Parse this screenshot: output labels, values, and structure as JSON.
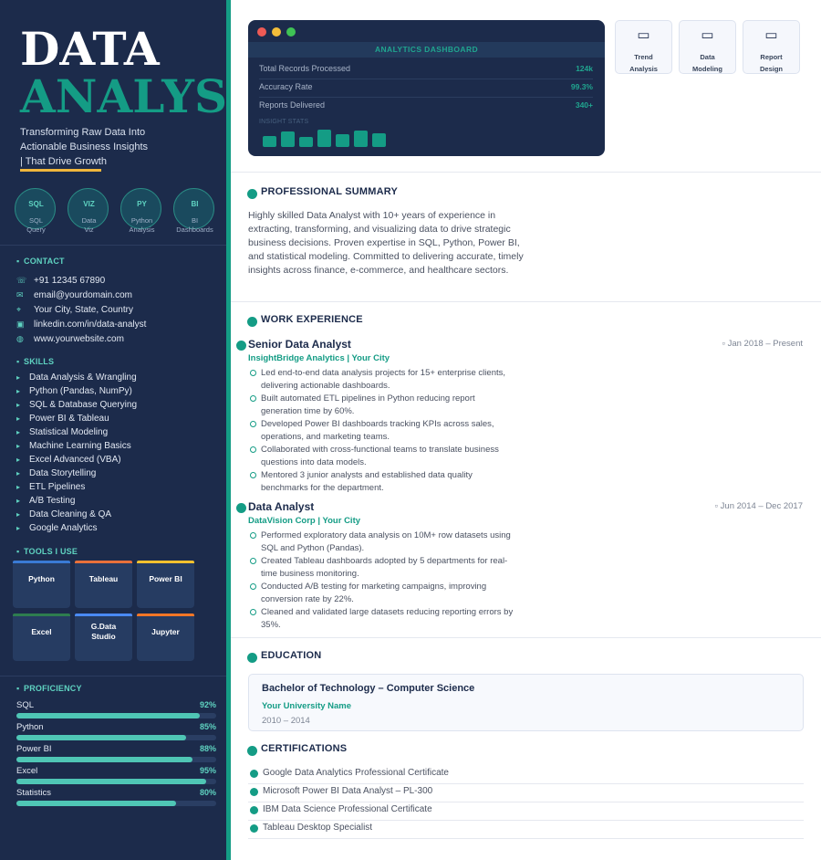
{
  "hero": {
    "line1": "DATA",
    "line2": "ANALYST",
    "tagline_1": "Transforming Raw Data Into",
    "tagline_2": "Actionable Business Insights",
    "tagline_3": "| That Drive Growth"
  },
  "badges": [
    {
      "abbr": "SQL",
      "label_1": "SQL",
      "label_2": "Query"
    },
    {
      "abbr": "VIZ",
      "label_1": "Data",
      "label_2": "Viz"
    },
    {
      "abbr": "PY",
      "label_1": "Python",
      "label_2": "Analysis"
    },
    {
      "abbr": "BI",
      "label_1": "BI",
      "label_2": "Dashboards"
    }
  ],
  "contact": {
    "heading": "CONTACT",
    "items": [
      {
        "icon": "phone-icon",
        "text": "+91 12345 67890"
      },
      {
        "icon": "email-icon",
        "text": "email@yourdomain.com"
      },
      {
        "icon": "location-icon",
        "text": "Your City, State, Country"
      },
      {
        "icon": "linkedin-icon",
        "text": "linkedin.com/in/data-analyst"
      },
      {
        "icon": "globe-icon",
        "text": "www.yourwebsite.com"
      }
    ]
  },
  "skills": {
    "heading": "SKILLS",
    "items": [
      "Data Analysis & Wrangling",
      "Python (Pandas, NumPy)",
      "SQL & Database Querying",
      "Power BI & Tableau",
      "Statistical Modeling",
      "Machine Learning Basics",
      "Excel Advanced (VBA)",
      "Data Storytelling",
      "ETL Pipelines",
      "A/B Testing",
      "Data Cleaning & QA",
      "Google Analytics"
    ]
  },
  "tools": {
    "heading": "TOOLS I USE",
    "items": [
      {
        "name_1": "Python",
        "name_2": "",
        "color": "#3a7bd5"
      },
      {
        "name_1": "Tableau",
        "name_2": "",
        "color": "#e8703a"
      },
      {
        "name_1": "Power BI",
        "name_2": "",
        "color": "#f2c12e"
      },
      {
        "name_1": "Excel",
        "name_2": "",
        "color": "#2e7d4f"
      },
      {
        "name_1": "G.Data",
        "name_2": "Studio",
        "color": "#4a8af4"
      },
      {
        "name_1": "Jupyter",
        "name_2": "",
        "color": "#f37626"
      }
    ]
  },
  "proficiency": {
    "heading": "PROFICIENCY",
    "items": [
      {
        "label": "SQL",
        "value": "92%",
        "fraction": 0.92
      },
      {
        "label": "Python",
        "value": "85%",
        "fraction": 0.85
      },
      {
        "label": "Power BI",
        "value": "88%",
        "fraction": 0.88
      },
      {
        "label": "Excel",
        "value": "95%",
        "fraction": 0.95
      },
      {
        "label": "Statistics",
        "value": "80%",
        "fraction": 0.8
      }
    ]
  },
  "dashboard": {
    "title": "ANALYTICS DASHBOARD",
    "rows": [
      {
        "label": "Total Records Processed",
        "value": "124k"
      },
      {
        "label": "Accuracy Rate",
        "value": "99.3%"
      },
      {
        "label": "Reports Delivered",
        "value": "340+"
      }
    ],
    "insight_label": "INSIGHT STATS",
    "insight_levels": [
      0.55,
      0.75,
      0.5,
      0.85,
      0.62,
      0.8,
      0.7
    ]
  },
  "features": [
    {
      "icon": "trend-icon",
      "label_1": "Trend",
      "label_2": "Analysis"
    },
    {
      "icon": "data-model-icon",
      "label_1": "Data",
      "label_2": "Modeling"
    },
    {
      "icon": "report-icon",
      "label_1": "Report",
      "label_2": "Design"
    }
  ],
  "summary": {
    "heading": "PROFESSIONAL SUMMARY",
    "text": "Highly skilled Data Analyst with 10+ years of experience in extracting, transforming, and visualizing data to drive strategic business decisions. Proven expertise in SQL, Python, Power BI, and statistical modeling. Committed to delivering accurate, timely insights across finance, e-commerce, and healthcare sectors."
  },
  "experience": {
    "heading": "WORK EXPERIENCE",
    "jobs": [
      {
        "title": "Senior Data Analyst",
        "date": "Jan 2018 – Present",
        "company": "InsightBridge Analytics  |  Your City",
        "bullets": [
          "Led end-to-end data analysis projects for 15+ enterprise clients, delivering actionable dashboards.",
          "Built automated ETL pipelines in Python reducing report generation time by 60%.",
          "Developed Power BI dashboards tracking KPIs across sales, operations, and marketing teams.",
          "Collaborated with cross-functional teams to translate business questions into data models.",
          "Mentored 3 junior analysts and established data quality benchmarks for the department."
        ]
      },
      {
        "title": "Data Analyst",
        "date": "Jun 2014 – Dec 2017",
        "company": "DataVision Corp  |  Your City",
        "bullets": [
          "Performed exploratory data analysis on 10M+ row datasets using SQL and Python (Pandas).",
          "Created Tableau dashboards adopted by 5 departments for real-time business monitoring.",
          "Conducted A/B testing for marketing campaigns, improving conversion rate by 22%.",
          "Cleaned and validated large datasets reducing reporting errors by 35%."
        ]
      }
    ]
  },
  "education": {
    "heading": "EDUCATION",
    "degree": "Bachelor of Technology – Computer Science",
    "university": "Your University Name",
    "years": "2010 – 2014"
  },
  "certifications": {
    "heading": "CERTIFICATIONS",
    "items": [
      "Google Data Analytics Professional Certificate",
      "Microsoft Power BI Data Analyst – PL-300",
      "IBM Data Science Professional Certificate",
      "Tableau Desktop Specialist"
    ]
  },
  "colors": {
    "sidebar": "#1c2b4b",
    "accent": "#149c85",
    "highlight": "#f0b63c"
  }
}
